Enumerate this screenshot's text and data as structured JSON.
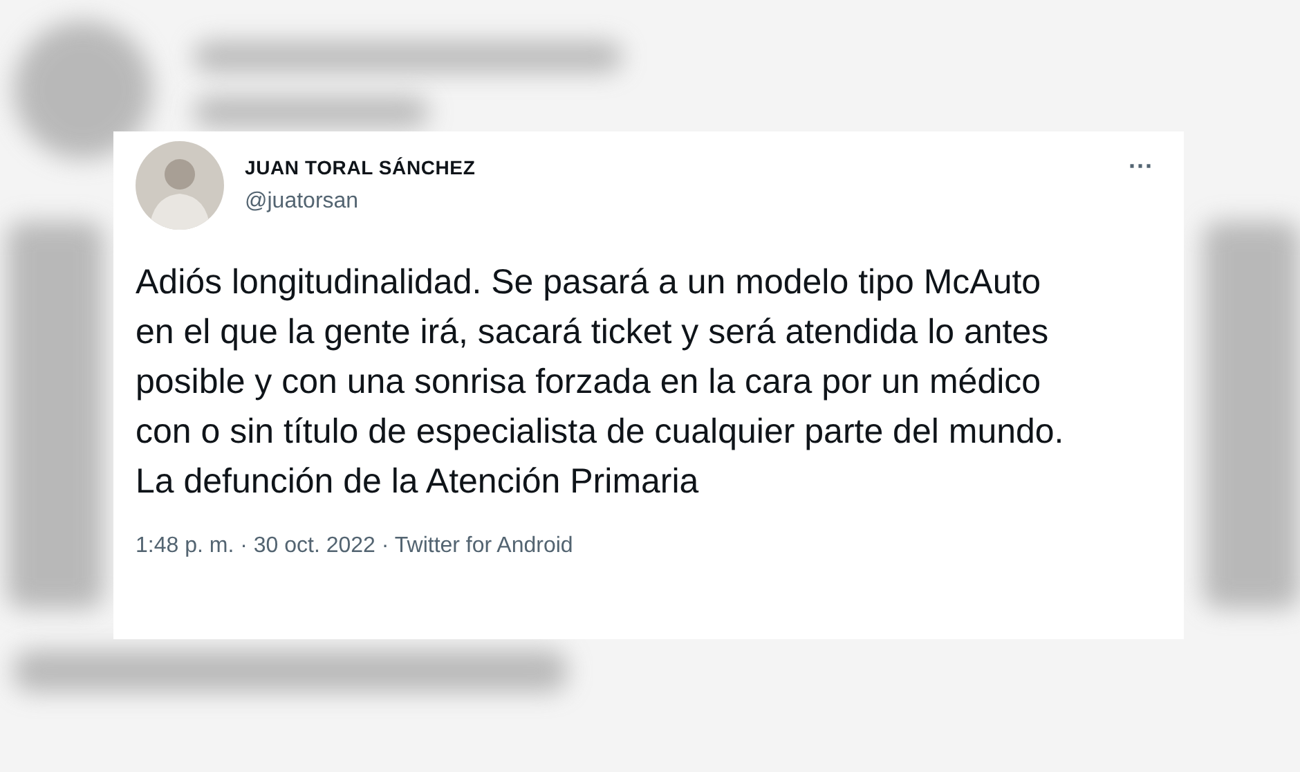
{
  "tweet": {
    "author": {
      "name": "JUAN TORAL SÁNCHEZ",
      "handle": "@juatorsan"
    },
    "menu": "···",
    "text": "Adiós longitudinalidad. Se pasará a un modelo tipo McAuto en el que la gente irá, sacará ticket y será atendida lo antes posible y con una sonrisa forzada en la cara por un médico con o sin título de especialista de cualquier parte del mundo. La defunción de la Atención Primaria",
    "meta": "1:48 p. m. · 30 oct. 2022 · Twitter for Android"
  }
}
